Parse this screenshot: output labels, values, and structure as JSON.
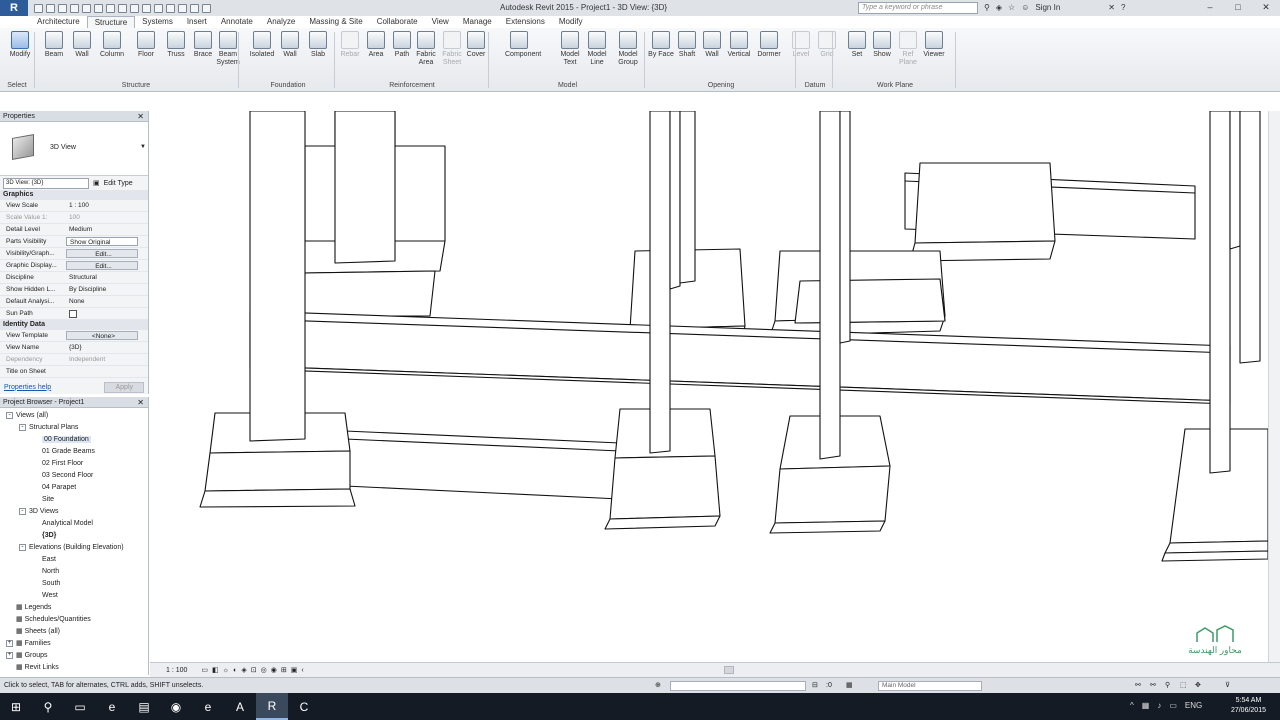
{
  "window": {
    "title": "Autodesk Revit 2015 -     Project1 - 3D View: {3D}",
    "app_button": "R",
    "search_placeholder": "Type a keyword or phrase",
    "sign_in": "Sign In"
  },
  "ribbon": {
    "tabs": [
      "Architecture",
      "Structure",
      "Systems",
      "Insert",
      "Annotate",
      "Analyze",
      "Massing & Site",
      "Collaborate",
      "View",
      "Manage",
      "Extensions",
      "Modify"
    ],
    "active_tab": "Structure",
    "tools": [
      {
        "label": "Modify",
        "state": "sel"
      },
      {
        "label": "Beam"
      },
      {
        "label": "Wall"
      },
      {
        "label": "Column"
      },
      {
        "label": "Floor"
      },
      {
        "label": "Truss"
      },
      {
        "label": "Brace"
      },
      {
        "label": "Beam System"
      },
      {
        "label": "Isolated"
      },
      {
        "label": "Wall"
      },
      {
        "label": "Slab"
      },
      {
        "label": "Rebar",
        "state": "dim"
      },
      {
        "label": "Area"
      },
      {
        "label": "Path"
      },
      {
        "label": "Fabric Area"
      },
      {
        "label": "Fabric Sheet",
        "state": "dim"
      },
      {
        "label": "Cover"
      },
      {
        "label": "Component"
      },
      {
        "label": "Model Text"
      },
      {
        "label": "Model Line"
      },
      {
        "label": "Model Group"
      },
      {
        "label": "By Face"
      },
      {
        "label": "Shaft"
      },
      {
        "label": "Wall"
      },
      {
        "label": "Vertical"
      },
      {
        "label": "Dormer"
      },
      {
        "label": "Level",
        "state": "dim"
      },
      {
        "label": "Grid",
        "state": "dim"
      },
      {
        "label": "Set"
      },
      {
        "label": "Show"
      },
      {
        "label": "Ref Plane",
        "state": "dim"
      },
      {
        "label": "Viewer"
      }
    ],
    "panels": [
      "Select",
      "Structure",
      "Foundation",
      "Reinforcement",
      "Model",
      "Opening",
      "Datum",
      "Work Plane"
    ]
  },
  "properties": {
    "title": "Properties",
    "type_name": "3D View",
    "instance": "3D View: {3D}",
    "edit_type": "Edit Type",
    "groups": [
      {
        "name": "Graphics",
        "rows": [
          {
            "k": "View Scale",
            "v": "1 : 100"
          },
          {
            "k": "Scale Value    1:",
            "v": "100",
            "dim": true
          },
          {
            "k": "Detail Level",
            "v": "Medium"
          },
          {
            "k": "Parts Visibility",
            "v": "Show Original",
            "style": "box"
          },
          {
            "k": "Visibility/Graph...",
            "v": "Edit...",
            "style": "btn"
          },
          {
            "k": "Graphic Display...",
            "v": "Edit...",
            "style": "btn"
          },
          {
            "k": "Discipline",
            "v": "Structural"
          },
          {
            "k": "Show Hidden L...",
            "v": "By Discipline"
          },
          {
            "k": "Default Analysi...",
            "v": "None"
          },
          {
            "k": "Sun Path",
            "v": "",
            "style": "chk"
          }
        ]
      },
      {
        "name": "Identity Data",
        "rows": [
          {
            "k": "View Template",
            "v": "<None>",
            "style": "btn"
          },
          {
            "k": "View Name",
            "v": "{3D}"
          },
          {
            "k": "Dependency",
            "v": "Independent",
            "dim": true
          },
          {
            "k": "Title on Sheet",
            "v": ""
          }
        ]
      }
    ],
    "help": "Properties help",
    "apply": "Apply"
  },
  "browser": {
    "title": "Project Browser - Project1",
    "items": [
      {
        "label": "Views (all)",
        "level": 0,
        "toggle": "-"
      },
      {
        "label": "Structural Plans",
        "level": 1,
        "toggle": "-"
      },
      {
        "label": "00 Foundation",
        "level": 2,
        "selected": true
      },
      {
        "label": "01 Grade Beams",
        "level": 2
      },
      {
        "label": "02 First Floor",
        "level": 2
      },
      {
        "label": "03 Second Floor",
        "level": 2
      },
      {
        "label": "04 Parapet",
        "level": 2
      },
      {
        "label": "Site",
        "level": 2
      },
      {
        "label": "3D Views",
        "level": 1,
        "toggle": "-"
      },
      {
        "label": "Analytical Model",
        "level": 2
      },
      {
        "label": "{3D}",
        "level": 2,
        "bold": true
      },
      {
        "label": "Elevations (Building Elevation)",
        "level": 1,
        "toggle": "-"
      },
      {
        "label": "East",
        "level": 2
      },
      {
        "label": "North",
        "level": 2
      },
      {
        "label": "South",
        "level": 2
      },
      {
        "label": "West",
        "level": 2
      },
      {
        "label": "Legends",
        "level": 0,
        "icon": true
      },
      {
        "label": "Schedules/Quantities",
        "level": 0,
        "icon": true
      },
      {
        "label": "Sheets (all)",
        "level": 0,
        "icon": true
      },
      {
        "label": "Families",
        "level": 0,
        "toggle": "+",
        "icon": true
      },
      {
        "label": "Groups",
        "level": 0,
        "toggle": "+",
        "icon": true
      },
      {
        "label": "Revit Links",
        "level": 0,
        "icon": true
      }
    ]
  },
  "view_bar": {
    "scale": "1 : 100"
  },
  "status_bar": {
    "message": "Click to select, TAB for alternates, CTRL adds, SHIFT unselects.",
    "model": "Main Model",
    "zero": ":0"
  },
  "taskbar": {
    "time": "5:54 AM",
    "date": "27/06/2015",
    "lang": "ENG"
  },
  "watermark": {
    "line1": "محاور الهندسة"
  }
}
